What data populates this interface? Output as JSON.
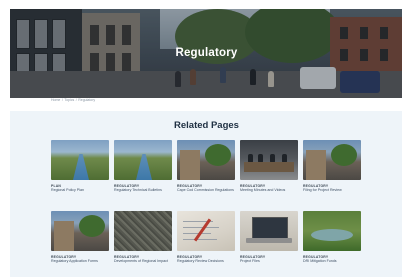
{
  "hero": {
    "title": "Regulatory"
  },
  "breadcrumb": [
    "Home",
    "Topics",
    "Regulatory"
  ],
  "related": {
    "heading": "Related Pages",
    "cards": [
      {
        "category": "PLAN",
        "title": "Regional Policy Plan",
        "image": "field-road-image"
      },
      {
        "category": "REGULATORY",
        "title": "Regulatory Technical Bulletins",
        "image": "field-road-image"
      },
      {
        "category": "REGULATORY",
        "title": "Cape Cod Commission Regulations",
        "image": "street-image"
      },
      {
        "category": "REGULATORY",
        "title": "Meeting Minutes and Videos",
        "image": "meeting-image"
      },
      {
        "category": "REGULATORY",
        "title": "Filing for Project Review",
        "image": "street-image"
      },
      {
        "category": "REGULATORY",
        "title": "Regulatory Application Forms",
        "image": "street-image"
      },
      {
        "category": "REGULATORY",
        "title": "Developments of Regional Impact",
        "image": "aerial-image"
      },
      {
        "category": "REGULATORY",
        "title": "Regulatory Review Decisions",
        "image": "paper-image"
      },
      {
        "category": "REGULATORY",
        "title": "Project Files",
        "image": "laptop-image"
      },
      {
        "category": "REGULATORY",
        "title": "DRI Mitigation Funds",
        "image": "pond-image"
      }
    ]
  }
}
